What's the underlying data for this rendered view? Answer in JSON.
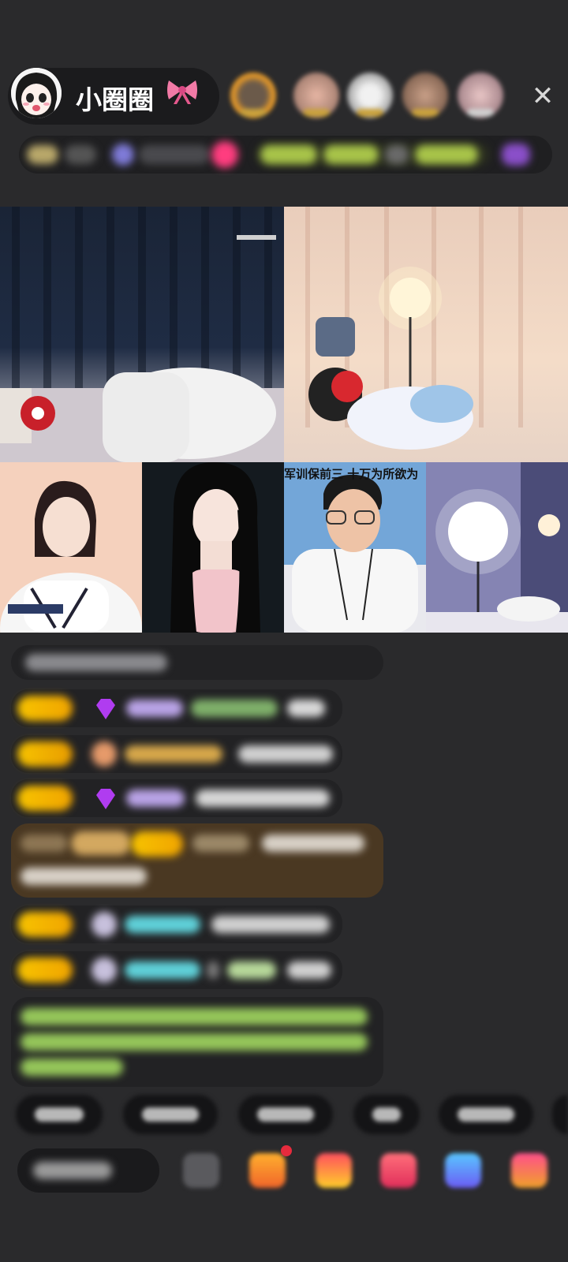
{
  "header": {
    "host_name": "小圈圈"
  },
  "video_grid": {
    "caption_guest_3": "军训保前三 十万为所欲为"
  },
  "colors": {
    "background": "#2a2a2c",
    "level_badge": "#f7c300",
    "chat_name_purple": "#b9a3e6",
    "chat_name_cyan": "#5fd0d8",
    "highlight_bg": "#5a4326",
    "system_text_green": "#a6d564"
  },
  "icons": {
    "close": "close-icon",
    "bow": "bow-icon",
    "gem": "gem-icon",
    "emoji": "emoji-icon",
    "gift": "gift-icon"
  }
}
